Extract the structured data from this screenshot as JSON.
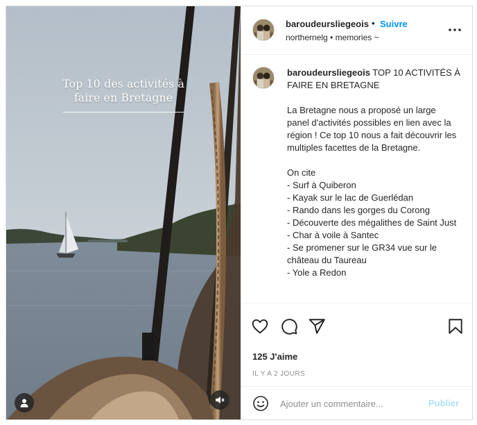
{
  "media": {
    "overlay_title": "Top 10 des activités à faire en Bretagne",
    "user_button_icon": "user-icon",
    "mute_button_icon": "volume-muted-icon"
  },
  "header": {
    "username": "baroudeursliegeois",
    "separator": "•",
    "follow_label": "Suivre",
    "subtitle": "northernelg • memories ~",
    "more_icon": "more-horizontal-icon"
  },
  "caption": {
    "username": "baroudeursliegeois",
    "text": " TOP 10 ACTIVITÉS À FAIRE EN BRETAGNE\n\nLa Bretagne nous a proposé un large panel d'activités possibles en lien avec la région ! Ce top 10 nous a fait découvrir les multiples facettes de la Bretagne.\n\nOn cite\n- Surf à Quiberon\n- Kayak sur le lac de Guerlédan\n- Rando dans les gorges du Corong\n- Découverte des mégalithes de Saint Just\n- Char à voile à Santec\n- Se promener sur le GR34 vue sur le château du Taureau\n- Yole a Redon"
  },
  "actions": {
    "icons": [
      "heart-icon",
      "comment-icon",
      "share-icon",
      "bookmark-icon"
    ],
    "likes": "125 J'aime",
    "time": "IL Y A 2 JOURS"
  },
  "comment": {
    "placeholder": "Ajouter un commentaire...",
    "publish_label": "Publier",
    "emoji_icon": "emoji-icon"
  },
  "colors": {
    "accent": "#0095f6",
    "publish_disabled": "#b2dffc",
    "text": "#262626",
    "secondary": "#8e8e8e",
    "border": "#dbdbdb"
  }
}
